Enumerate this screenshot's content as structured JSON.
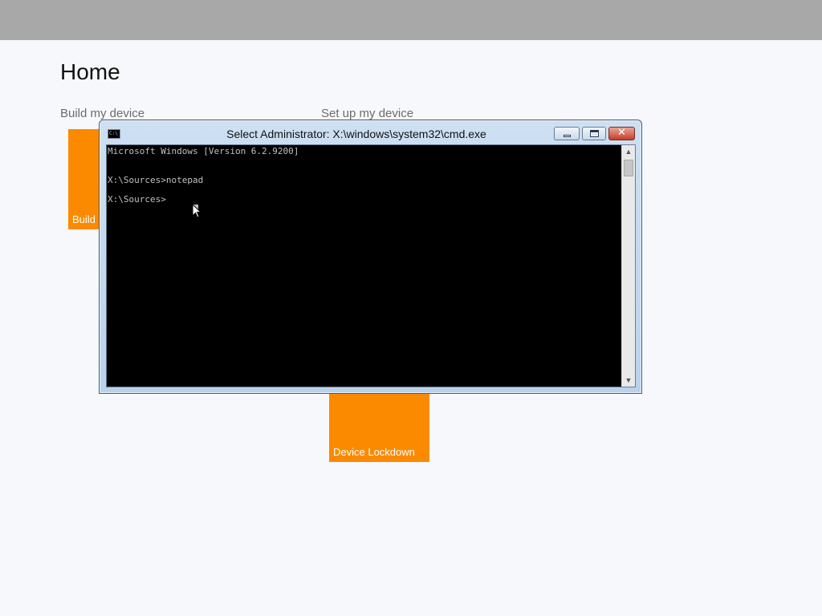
{
  "page": {
    "title": "Home",
    "sections": {
      "build": "Build my device",
      "setup": "Set up my device"
    },
    "tiles": {
      "build": "Build",
      "lockdown": "Device Lockdown"
    }
  },
  "cmd": {
    "title": "Select Administrator: X:\\windows\\system32\\cmd.exe",
    "icon_text": "C:\\",
    "lines": [
      "Microsoft Windows [Version 6.2.9200]",
      "X:\\Sources>notepad",
      "X:\\Sources>"
    ],
    "buttons": {
      "close_glyph": "✕"
    },
    "scroll": {
      "up": "▲",
      "down": "▼"
    }
  },
  "colors": {
    "accent_tile": "#fb8a00",
    "topbar": "#a8a8a8",
    "console_bg": "#000000",
    "console_text": "#c0c0c0"
  }
}
